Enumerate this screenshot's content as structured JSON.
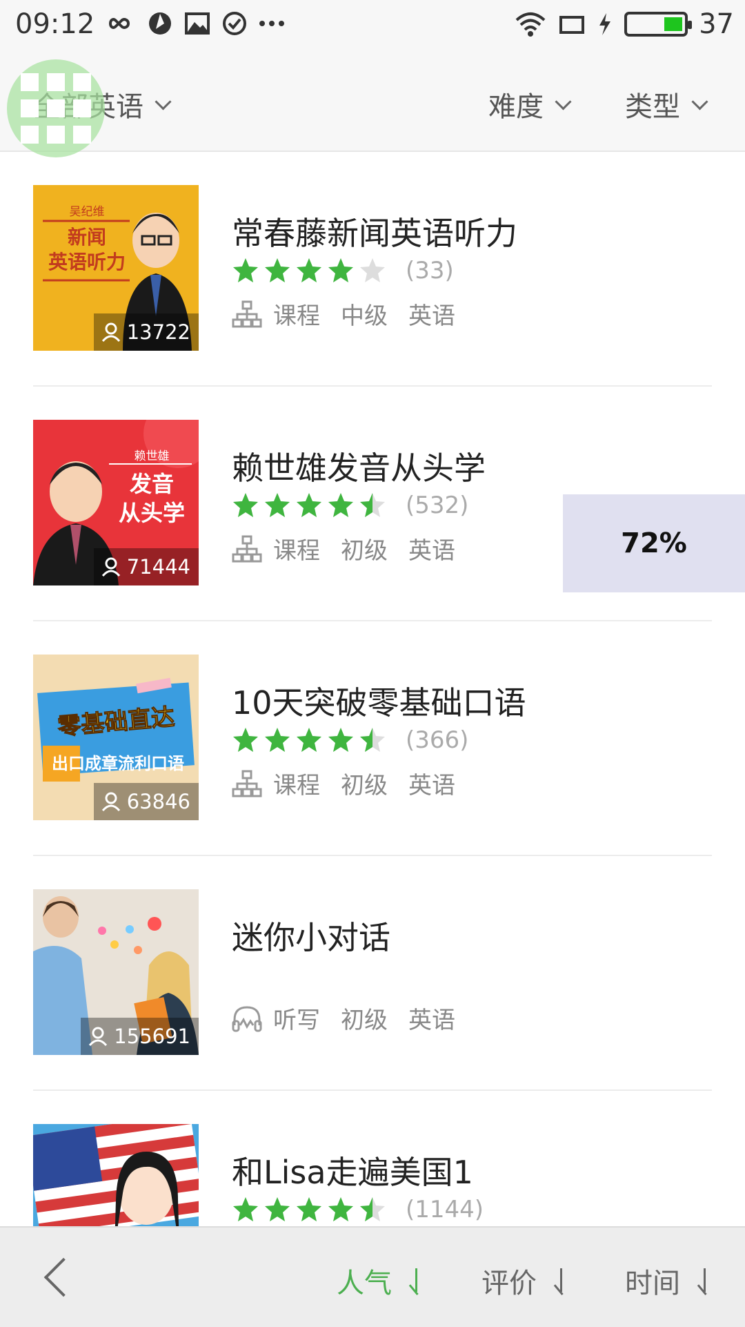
{
  "status_bar": {
    "time": "09:12",
    "battery_level": "37",
    "left_icons": [
      "infinity-icon",
      "aperture-icon",
      "image-icon",
      "check-circle-icon",
      "more-icon"
    ],
    "right_icons": [
      "wifi-icon",
      "screen-icon",
      "charging-icon",
      "battery-icon"
    ]
  },
  "filters": {
    "category": "全部英语",
    "difficulty": "难度",
    "type": "类型"
  },
  "courses": [
    {
      "title": "常春藤新闻英语听力",
      "learners": "13722",
      "rating": 4.0,
      "rating_count": "(33)",
      "kind_icon": "hierarchy-icon",
      "kind": "课程",
      "level": "中级",
      "language": "英语",
      "thumb_title": "新闻\n英语听力",
      "thumb_author": "吴纪维"
    },
    {
      "title": "赖世雄发音从头学",
      "learners": "71444",
      "rating": 4.5,
      "rating_count": "(532)",
      "kind_icon": "hierarchy-icon",
      "kind": "课程",
      "level": "初级",
      "language": "英语",
      "thumb_title": "发音\n从头学",
      "thumb_author": "赖世雄"
    },
    {
      "title": "10天突破零基础口语",
      "learners": "63846",
      "rating": 4.5,
      "rating_count": "(366)",
      "kind_icon": "hierarchy-icon",
      "kind": "课程",
      "level": "初级",
      "language": "英语",
      "thumb_title": "零基础直达",
      "thumb_sub": "出口成章流利口语"
    },
    {
      "title": "迷你小对话",
      "learners": "155691",
      "rating": null,
      "rating_count": "",
      "kind_icon": "headphones-icon",
      "kind": "听写",
      "level": "初级",
      "language": "英语"
    },
    {
      "title": "和Lisa走遍美国1",
      "learners": "",
      "rating": 4.5,
      "rating_count": "(1144)",
      "kind_icon": "hierarchy-icon",
      "kind": "",
      "level": "",
      "language": ""
    }
  ],
  "overlay": {
    "percent": "72%"
  },
  "sort_bar": {
    "popular": "人气",
    "rating": "评价",
    "time": "时间",
    "active_color": "#4caf50"
  },
  "colors": {
    "star": "#3fb53f",
    "star_empty": "#dddddd"
  }
}
